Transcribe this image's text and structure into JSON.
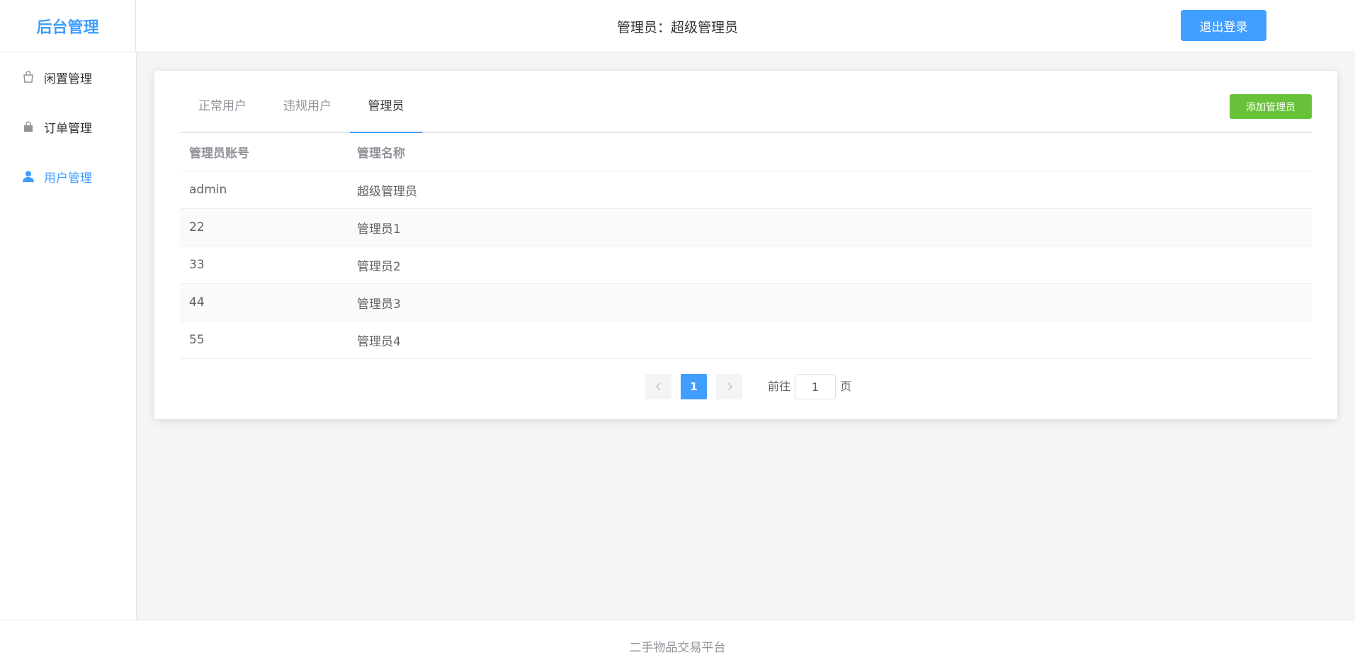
{
  "header": {
    "logo": "后台管理",
    "admin_label": "管理员：超级管理员",
    "logout": "退出登录"
  },
  "sidebar": {
    "items": [
      {
        "label": "闲置管理",
        "icon": "shopping-bag-icon"
      },
      {
        "label": "订单管理",
        "icon": "lock-bag-icon"
      },
      {
        "label": "用户管理",
        "icon": "user-icon",
        "active": true
      }
    ]
  },
  "tabs": [
    {
      "label": "正常用户"
    },
    {
      "label": "违规用户"
    },
    {
      "label": "管理员",
      "active": true
    }
  ],
  "add_button": "添加管理员",
  "table": {
    "headers": [
      "管理员账号",
      "管理名称"
    ],
    "rows": [
      {
        "account": "admin",
        "name": "超级管理员"
      },
      {
        "account": "22",
        "name": "管理员1"
      },
      {
        "account": "33",
        "name": "管理员2"
      },
      {
        "account": "44",
        "name": "管理员3"
      },
      {
        "account": "55",
        "name": "管理员4"
      }
    ]
  },
  "pagination": {
    "current_page": "1",
    "goto_prefix": "前往",
    "goto_value": "1",
    "goto_suffix": "页"
  },
  "footer": "二手物品交易平台",
  "colors": {
    "primary": "#409eff",
    "success": "#67c23a",
    "background": "#f5f5f5"
  }
}
